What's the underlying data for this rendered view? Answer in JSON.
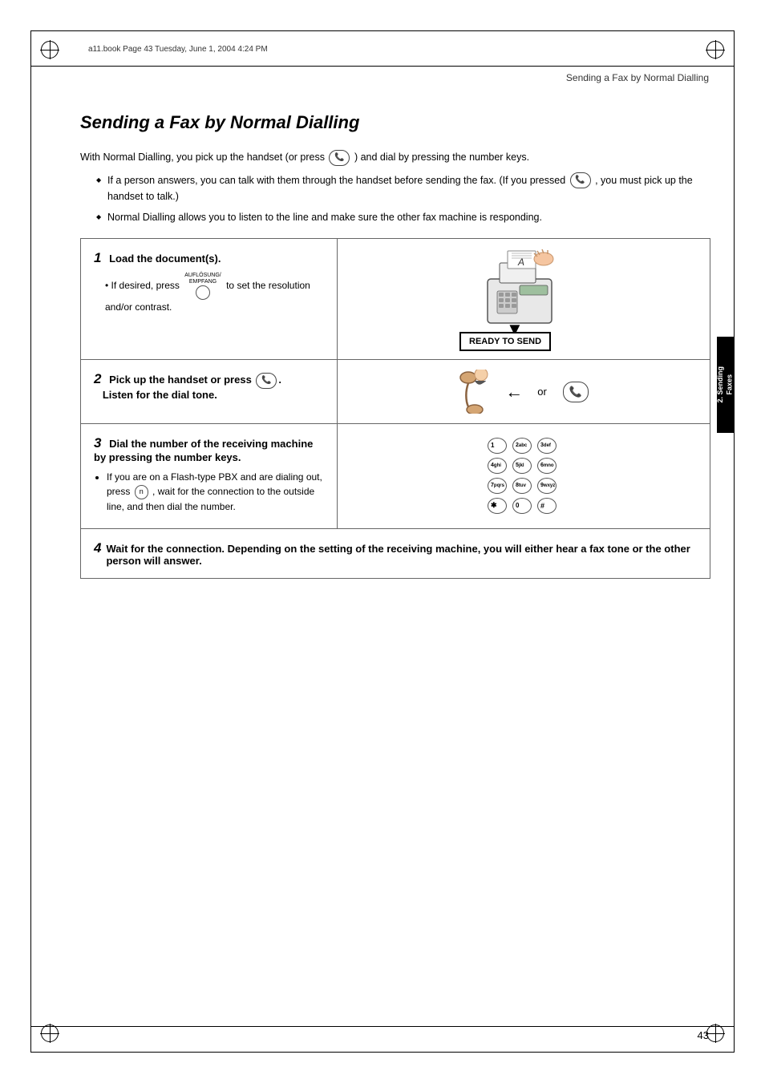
{
  "page": {
    "border_visible": true,
    "file_info": "a11.book  Page 43  Tuesday, June 1, 2004  4:24 PM",
    "page_number": "43",
    "section_header": "Sending a Fax by Normal Dialling",
    "sidebar_tab_line1": "2. Sending",
    "sidebar_tab_line2": "Faxes"
  },
  "title": "Sending a Fax by Normal Dialling",
  "intro": {
    "line1": "With Normal Dialling, you pick up the handset (or press",
    "line1_end": ") and dial by pressing the number keys.",
    "bullets": [
      "If a person answers, you can talk with them through the handset before sending the fax. (If you pressed  , you must pick up the handset to talk.)",
      "Normal Dialling allows you to listen to the line and make sure the other fax machine is responding."
    ]
  },
  "steps": [
    {
      "number": "1",
      "title": "Load the document(s).",
      "sub": "If desired, press      to set the resolution and/or contrast.",
      "sub_prefix": "•",
      "button_label": "AUFLÖSUNG/EMPFANG",
      "has_illustration": true,
      "illustration_type": "fax_machine",
      "ready_to_send": "READY TO SEND"
    },
    {
      "number": "2",
      "title": "Pick up the handset or press",
      "title_end": ".",
      "title_line2": "Listen for the dial tone.",
      "has_illustration": true,
      "illustration_type": "handset_or"
    },
    {
      "number": "3",
      "title": "Dial the number of the receiving machine by pressing the number keys.",
      "sub_items": [
        "If you are on a Flash-type PBX and are dialing out, press      , wait for the connection to the outside line, and then dial the number."
      ],
      "has_illustration": true,
      "illustration_type": "keypad",
      "keypad_keys": [
        "1",
        "2abc",
        "3def",
        "4ghi",
        "5jkl",
        "6mno",
        "7pqrs",
        "8tuv",
        "9wxyz",
        "*",
        "0",
        "#"
      ]
    },
    {
      "number": "4",
      "title": "Wait for the connection. Depending on the setting of the receiving machine, you will either hear a fax tone or the other person will answer.",
      "full_width": true
    }
  ]
}
